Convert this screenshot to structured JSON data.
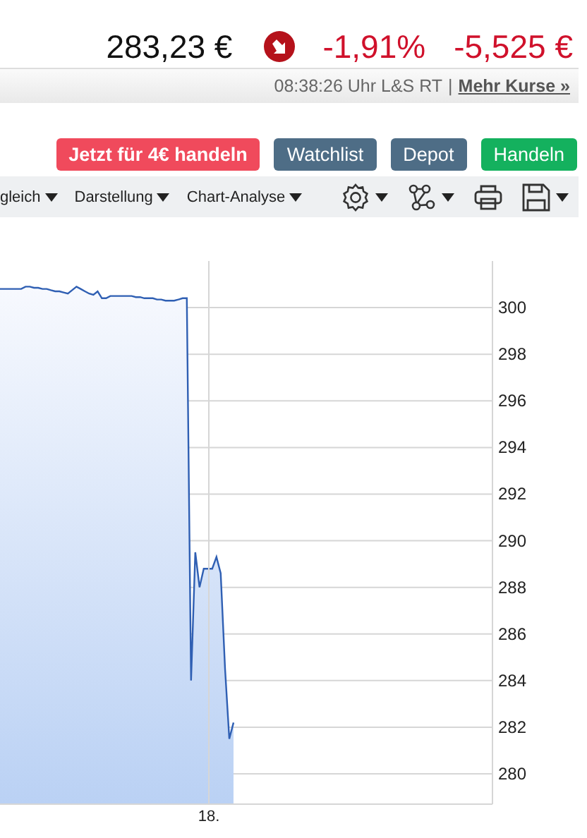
{
  "quote": {
    "price": "283,23 €",
    "falling": true,
    "change_pct": "-1,91%",
    "change_abs": "-5,525 €"
  },
  "quote_bar": {
    "time": "08:38:26 Uhr L&S RT",
    "separator": "|",
    "link": "Mehr Kurse »"
  },
  "buttons": [
    {
      "label": "Jetzt für 4€ handeln",
      "kind": "promo"
    },
    {
      "label": "Watchlist",
      "kind": "secondary"
    },
    {
      "label": "Depot",
      "kind": "secondary"
    },
    {
      "label": "Handeln",
      "kind": "trade"
    }
  ],
  "toolbar": {
    "menus": [
      "gleich",
      "Darstellung",
      "Chart-Analyse"
    ]
  },
  "chart": {
    "chart_data": {
      "type": "area",
      "categories": [
        null,
        null,
        null,
        null,
        null,
        null,
        null,
        null,
        null,
        null,
        null,
        null,
        null,
        null,
        null,
        null,
        null,
        null,
        null,
        null,
        null,
        null,
        null,
        null,
        null,
        null,
        null,
        null,
        null,
        null,
        null,
        null,
        null,
        null,
        null,
        null,
        null,
        null,
        null,
        null,
        null,
        null,
        null,
        null,
        null,
        null,
        null,
        null,
        null,
        null,
        null,
        null,
        null,
        null,
        null,
        null,
        null,
        null,
        null,
        null,
        null,
        null,
        null,
        null,
        null,
        null,
        null,
        null,
        null,
        null,
        null,
        null,
        null,
        null,
        null,
        null,
        null,
        null,
        null,
        null,
        null,
        null,
        null,
        null,
        null,
        null,
        null,
        null,
        null,
        null,
        null,
        null,
        null,
        null,
        null,
        null,
        null,
        null,
        null,
        null,
        null,
        null,
        null,
        null,
        null,
        null,
        null,
        null,
        null,
        null,
        null,
        null,
        null,
        null,
        null,
        null,
        null
      ],
      "series": [
        {
          "color": "#2f5fb3",
          "values": [
            300.8,
            300.8,
            300.8,
            300.8,
            300.8,
            300.8,
            300.9,
            300.9,
            300.85,
            300.85,
            300.8,
            300.8,
            300.75,
            300.7,
            300.7,
            300.65,
            300.6,
            300.75,
            300.9,
            300.8,
            300.7,
            300.6,
            300.55,
            300.7,
            300.4,
            300.4,
            300.5,
            300.5,
            300.5,
            300.5,
            300.5,
            300.5,
            300.45,
            300.45,
            300.4,
            300.4,
            300.4,
            300.35,
            300.35,
            300.3,
            300.3,
            300.3,
            300.35,
            300.4,
            300.4,
            284.0,
            289.5,
            288.0,
            288.8,
            288.8,
            288.8,
            289.3,
            288.6,
            284.5,
            281.5,
            282.2,
            null,
            null,
            null,
            null,
            null,
            null,
            null,
            null,
            null,
            null,
            null,
            null,
            null,
            null,
            null,
            null,
            null,
            null,
            null,
            null,
            null,
            null,
            null,
            null,
            null,
            null,
            null,
            null,
            null,
            null,
            null,
            null,
            null,
            null,
            null,
            null,
            null,
            null,
            null,
            null,
            null,
            null,
            null,
            null,
            null,
            null,
            null,
            null,
            null,
            null,
            null,
            null,
            null,
            null,
            null,
            null,
            null,
            null,
            null,
            null,
            null
          ]
        }
      ],
      "ylim": [
        278.7,
        302
      ],
      "grid": true,
      "annotations": [
        "18."
      ],
      "yticks": [
        {
          "value": 280,
          "label": "280"
        },
        {
          "value": 282,
          "label": "282"
        },
        {
          "value": 284,
          "label": "284"
        },
        {
          "value": 286,
          "label": "286"
        },
        {
          "value": 288,
          "label": "288"
        },
        {
          "value": 290,
          "label": "290"
        },
        {
          "value": 292,
          "label": "292"
        },
        {
          "value": 294,
          "label": "294"
        },
        {
          "value": 296,
          "label": "296"
        },
        {
          "value": 298,
          "label": "298"
        },
        {
          "value": 300,
          "label": "300"
        }
      ]
    }
  }
}
